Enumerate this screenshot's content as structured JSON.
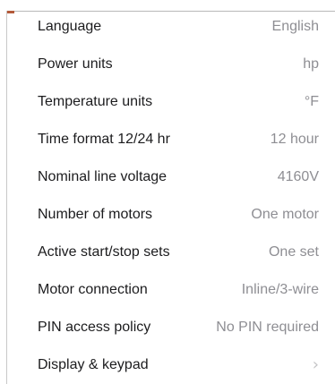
{
  "settings": {
    "items": [
      {
        "label": "Language",
        "value": "English"
      },
      {
        "label": "Power units",
        "value": "hp"
      },
      {
        "label": "Temperature units",
        "value": "°F"
      },
      {
        "label": "Time format 12/24 hr",
        "value": "12 hour"
      },
      {
        "label": "Nominal line voltage",
        "value": "4160V"
      },
      {
        "label": "Number of motors",
        "value": "One motor"
      },
      {
        "label": "Active start/stop sets",
        "value": "One set"
      },
      {
        "label": "Motor connection",
        "value": "Inline/3-wire"
      },
      {
        "label": "PIN access policy",
        "value": "No PIN required"
      },
      {
        "label": "Display & keypad",
        "value": null,
        "icon": "chevron-right-icon"
      }
    ]
  },
  "colors": {
    "label": "#1c1c1e",
    "value": "#8e8e93",
    "accent_mark": "#b35a3a"
  }
}
